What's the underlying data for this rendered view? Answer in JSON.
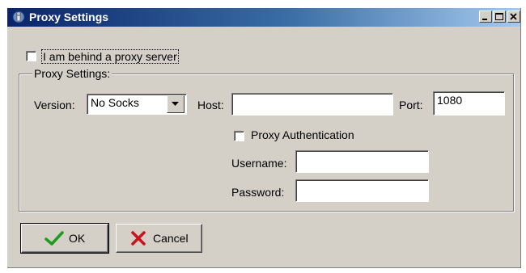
{
  "window": {
    "title": "Proxy Settings"
  },
  "behind_proxy": {
    "label": "I am behind a proxy server",
    "checked": false
  },
  "proxy_group": {
    "title": "Proxy Settings:",
    "version_label": "Version:",
    "version_value": "No Socks",
    "host_label": "Host:",
    "host_value": "",
    "port_label": "Port:",
    "port_value": "1080",
    "auth_label": "Proxy Authentication",
    "auth_checked": false,
    "username_label": "Username:",
    "username_value": "",
    "password_label": "Password:",
    "password_value": ""
  },
  "buttons": {
    "ok_label": "OK",
    "cancel_label": "Cancel"
  },
  "icons": {
    "app": "wrench-icon",
    "minimize": "minimize-icon",
    "maximize": "maximize-icon",
    "close": "close-icon",
    "dropdown": "triangle-down-icon",
    "ok": "checkmark-icon",
    "cancel": "cross-icon"
  },
  "colors": {
    "titlebar_start": "#0a246a",
    "titlebar_end": "#a6caf0",
    "face": "#d4d0c8",
    "ok_check": "#1e9a1e",
    "cancel_x": "#c8141e"
  }
}
